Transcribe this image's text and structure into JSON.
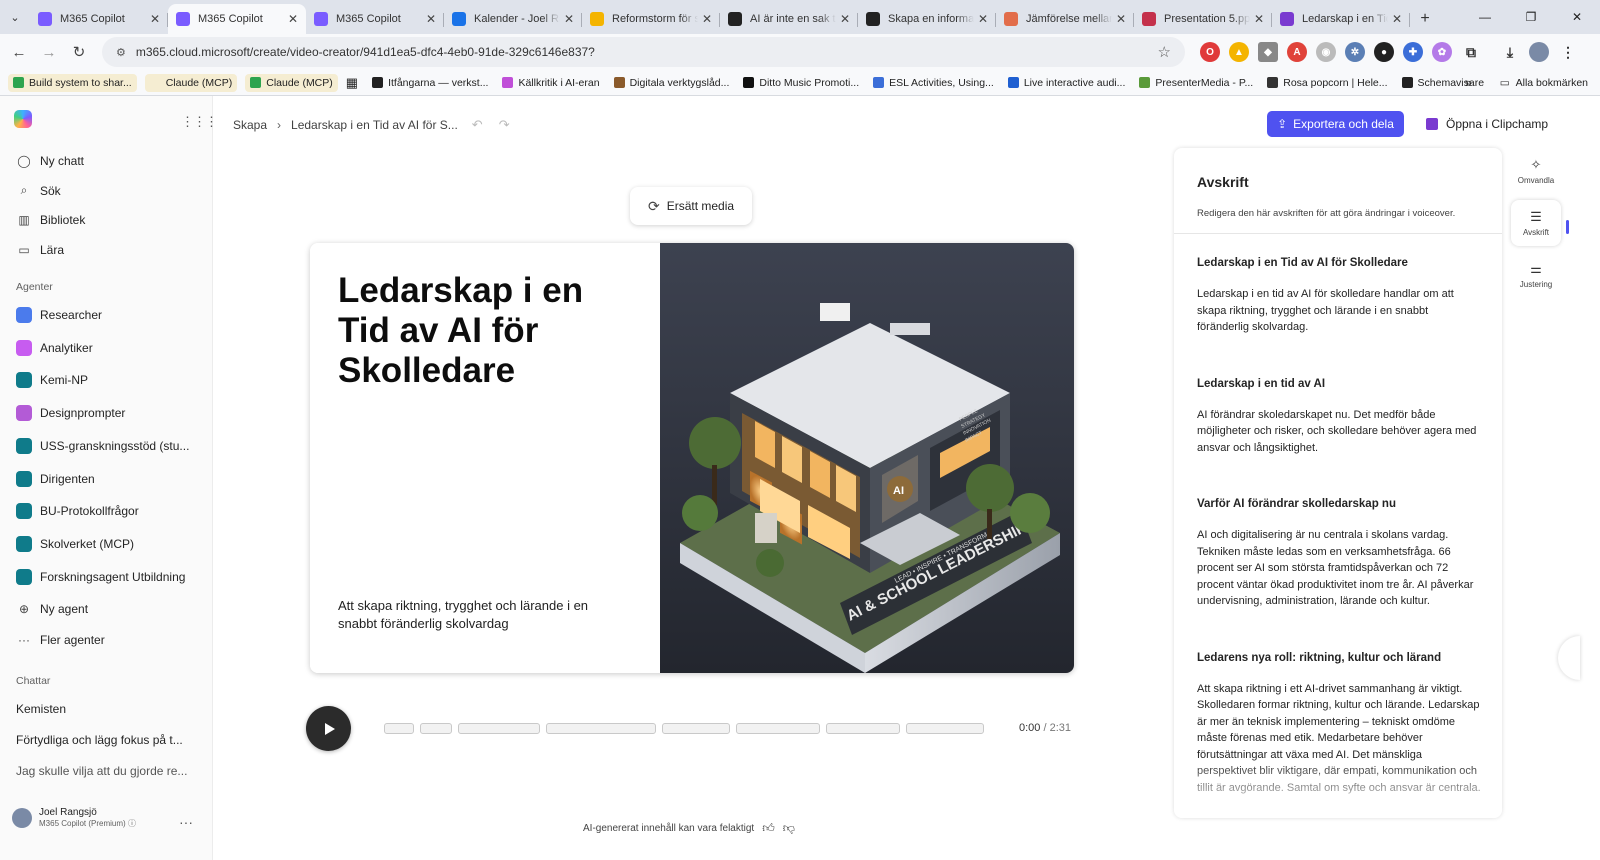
{
  "tabs": [
    {
      "title": "M365 Copilot",
      "color": "#7a5cff",
      "active": false
    },
    {
      "title": "M365 Copilot",
      "color": "#7a5cff",
      "active": true
    },
    {
      "title": "M365 Copilot",
      "color": "#7a5cff",
      "active": false
    },
    {
      "title": "Kalender - Joel Ra",
      "color": "#1a73e8",
      "active": false
    },
    {
      "title": "Reformstorm för s",
      "color": "#f4b400",
      "active": false
    },
    {
      "title": "AI är inte en sak ti",
      "color": "#222222",
      "active": false
    },
    {
      "title": "Skapa en informati",
      "color": "#222222",
      "active": false
    },
    {
      "title": "Jämförelse mellan",
      "color": "#e26d4a",
      "active": false
    },
    {
      "title": "Presentation 5.ppt",
      "color": "#c4314b",
      "active": false
    },
    {
      "title": "Ledarskap i en Tid",
      "color": "#7a3ad0",
      "active": false
    }
  ],
  "address": {
    "url": "m365.cloud.microsoft/create/video-creator/941d1ea5-dfc4-4eb0-91de-329c6146e837?"
  },
  "bookmarks": [
    {
      "label": "Build system to shar...",
      "color": "#2da44e",
      "chip": true
    },
    {
      "label": "Claude (MCP)",
      "color": "#f5edd2",
      "chip": true
    },
    {
      "label": "Claude (MCP)",
      "color": "#2da44e",
      "chip": true
    },
    {
      "label": "Itfångarna — verkst...",
      "color": "#222222",
      "chip": false
    },
    {
      "label": "Källkritik i AI-eran",
      "color": "#c04fd8",
      "chip": false
    },
    {
      "label": "Digitala verktygslåd...",
      "color": "#8a5a2b",
      "chip": false
    },
    {
      "label": "Ditto Music Promoti...",
      "color": "#111111",
      "chip": false
    },
    {
      "label": "ESL Activities, Using...",
      "color": "#3b6ed8",
      "chip": false
    },
    {
      "label": "Live interactive audi...",
      "color": "#1f5fd1",
      "chip": false
    },
    {
      "label": "PresenterMedia - P...",
      "color": "#5a9a3a",
      "chip": false
    },
    {
      "label": "Rosa popcorn | Hele...",
      "color": "#333333",
      "chip": false
    },
    {
      "label": "Schemavisare",
      "color": "#222222",
      "chip": false
    }
  ],
  "bookmarks_more": "»",
  "bookmarks_all": "Alla bokmärken",
  "sidebar": {
    "nav": [
      {
        "label": "Ny chatt",
        "icon": "chat-bubble-icon",
        "glyph": "◯"
      },
      {
        "label": "Sök",
        "icon": "search-icon",
        "glyph": "⌕"
      },
      {
        "label": "Bibliotek",
        "icon": "library-icon",
        "glyph": "▥"
      },
      {
        "label": "Lära",
        "icon": "book-icon",
        "glyph": "▭"
      }
    ],
    "agents_heading": "Agenter",
    "agents": [
      {
        "label": "Researcher",
        "icon": "researcher-icon",
        "color": "#4b7bec"
      },
      {
        "label": "Analytiker",
        "icon": "analyst-icon",
        "color": "#c75cf0"
      },
      {
        "label": "Kemi-NP",
        "icon": "agent-icon",
        "color": "#0f7b8a"
      },
      {
        "label": "Designprompter",
        "icon": "agent-icon",
        "color": "#b35bd6"
      },
      {
        "label": "USS-granskningsstöd (stu...",
        "icon": "agent-icon",
        "color": "#0f7b8a"
      },
      {
        "label": "Dirigenten",
        "icon": "agent-icon",
        "color": "#0f7b8a"
      },
      {
        "label": "BU-Protokollfrågor",
        "icon": "agent-icon",
        "color": "#0f7b8a"
      },
      {
        "label": "Skolverket (MCP)",
        "icon": "agent-icon",
        "color": "#0f7b8a"
      },
      {
        "label": "Forskningsagent Utbildning",
        "icon": "agent-icon",
        "color": "#0f7b8a"
      }
    ],
    "new_agent": "Ny agent",
    "more_agents": "Fler agenter",
    "chats_heading": "Chattar",
    "chats": [
      "Kemisten",
      "Förtydliga och lägg fokus på t...",
      "Jag skulle vilja att du gjorde re..."
    ],
    "user": {
      "name": "Joel Rangsjö",
      "plan": "M365 Copilot (Premium)"
    }
  },
  "header": {
    "crumb_root": "Skapa",
    "crumb_current": "Ledarskap i en Tid av AI för S...",
    "export_label": "Exportera och dela",
    "clipchamp_label": "Öppna i Clipchamp"
  },
  "canvas": {
    "replace_media": "Ersätt media",
    "slide_title": "Ledarskap i en Tid av AI för Skolledare",
    "slide_subtitle": "Att skapa riktning, trygghet och lärande i en snabbt föränderlig skolvardag",
    "image_sign": "AI & SCHOOL LEADERSHIP",
    "image_tagline": "LEAD • INSPIRE • TRANSFORM",
    "image_wall": [
      "PEOPLE",
      "STRATEGY",
      "INNOVATION",
      "IMPACT"
    ],
    "image_badge": "AI"
  },
  "player": {
    "current": "0:00",
    "total": "2:31",
    "progress": 0,
    "segments": 8
  },
  "disclaimer": "AI-genererat innehåll kan vara felaktigt",
  "transcript": {
    "title": "Avskrift",
    "description": "Redigera den här avskriften för att göra ändringar i voiceover.",
    "sections": [
      {
        "heading": "Ledarskap i en Tid av AI för Skolledare",
        "text": "Ledarskap i en tid av AI för skolledare handlar om att skapa riktning, trygghet och lärande i en snabbt föränderlig skolvardag."
      },
      {
        "heading": "Ledarskap i en tid av AI",
        "text": "AI förändrar skoledarskapet nu. Det medför både möjligheter och risker, och skolledare behöver agera med ansvar och långsiktighet."
      },
      {
        "heading": "Varför AI förändrar skolledarskap nu",
        "text": "AI och digitalisering är nu centrala i skolans vardag. Tekniken måste ledas som en verksamhetsfråga. 66 procent ser AI som största framtidspåverkan och 72 procent väntar ökad produktivitet inom tre år. AI påverkar undervisning, administration, lärande och kultur."
      },
      {
        "heading": "Ledarens nya roll: riktning, kultur och lärand",
        "text": "Att skapa riktning i ett AI-drivet sammanhang är viktigt. Skolledaren formar riktning, kultur och lärande. Ledarskap är mer än teknisk implementering – tekniskt omdöme måste förenas med etik. Medarbetare behöver förutsättningar att växa med AI. Det mänskliga perspektivet blir viktigare, där empati, kommunikation och tillit är avgörande. Samtal om syfte och ansvar är centrala."
      }
    ]
  },
  "rail": [
    {
      "label": "Omvandla",
      "icon": "sparkle-icon",
      "glyph": "✧",
      "active": false
    },
    {
      "label": "Avskrift",
      "icon": "transcript-icon",
      "glyph": "☰",
      "active": true
    },
    {
      "label": "Justering",
      "icon": "sliders-icon",
      "glyph": "⚌",
      "active": false
    }
  ],
  "colors": {
    "accent": "#4f52f0",
    "clipchamp": "#7a3ad0"
  }
}
